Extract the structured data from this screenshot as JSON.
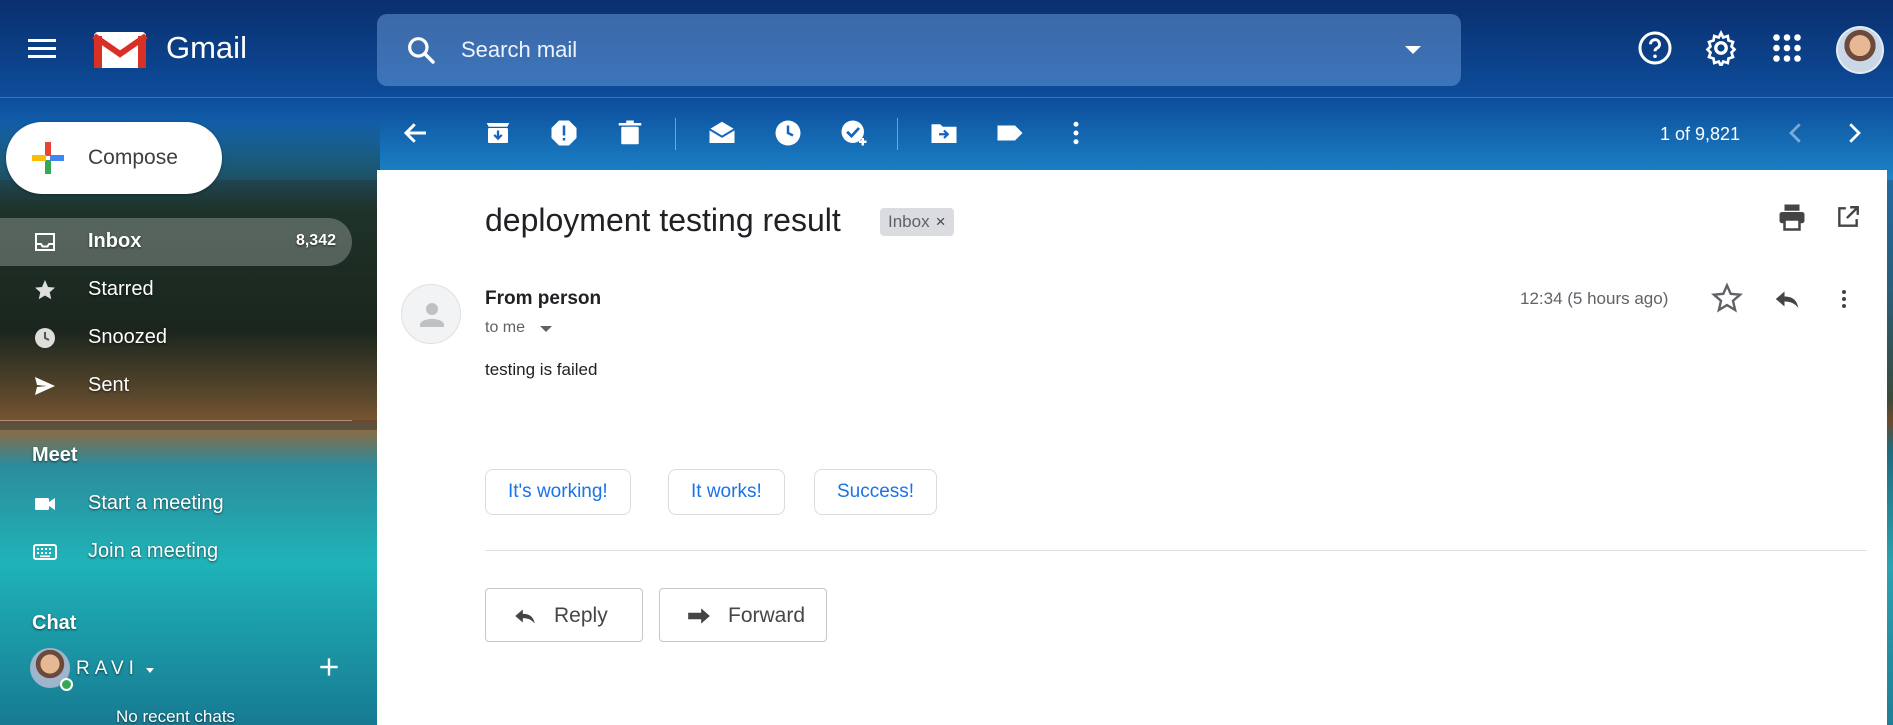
{
  "header": {
    "brand": "Gmail",
    "search_placeholder": "Search mail"
  },
  "compose": {
    "label": "Compose"
  },
  "sidebar": {
    "items": [
      {
        "label": "Inbox",
        "count": "8,342",
        "icon": "inbox-icon"
      },
      {
        "label": "Starred",
        "icon": "star-icon"
      },
      {
        "label": "Snoozed",
        "icon": "clock-icon"
      },
      {
        "label": "Sent",
        "icon": "send-icon"
      }
    ],
    "meet": {
      "title": "Meet",
      "items": [
        {
          "label": "Start a meeting",
          "icon": "video-icon"
        },
        {
          "label": "Join a meeting",
          "icon": "keyboard-icon"
        }
      ]
    },
    "chat": {
      "title": "Chat",
      "user": "RAVI",
      "empty_text": "No recent chats"
    }
  },
  "toolbar": {
    "page_count": "1 of 9,821"
  },
  "email": {
    "subject": "deployment testing result",
    "label": "Inbox",
    "sender": "From person",
    "recipient": "to me",
    "timestamp": "12:34 (5 hours ago)",
    "body": "testing is failed",
    "smart_replies": [
      "It's working!",
      "It works!",
      "Success!"
    ],
    "reply_label": "Reply",
    "forward_label": "Forward"
  },
  "colors": {
    "accent": "#1a73e8",
    "online": "#34a853"
  }
}
